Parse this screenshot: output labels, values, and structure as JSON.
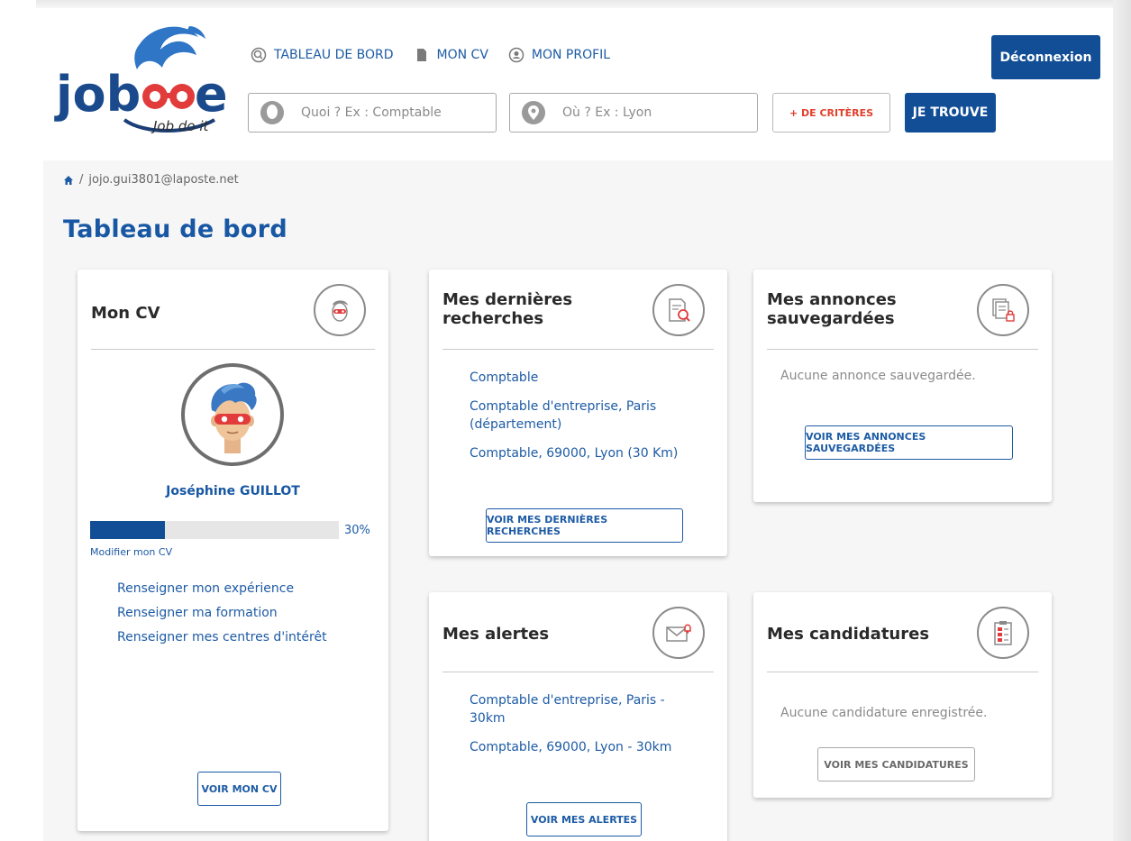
{
  "logo": {
    "brand": "jobdoe",
    "tagline": "Job do it"
  },
  "nav": [
    {
      "label": "TABLEAU DE BORD",
      "icon": "dashboard-icon"
    },
    {
      "label": "MON CV",
      "icon": "document-icon"
    },
    {
      "label": "MON PROFIL",
      "icon": "profile-icon"
    }
  ],
  "header": {
    "logout_label": "Déconnexion",
    "criteria_label": "+ DE CRITÈRES",
    "find_label": "JE TROUVE"
  },
  "search": {
    "what_placeholder": "Quoi ? Ex : Comptable",
    "where_placeholder": "Où ? Ex : Lyon"
  },
  "breadcrumb": {
    "separator": "/",
    "current": "jojo.gui3801@laposte.net"
  },
  "page_title": "Tableau de bord",
  "cv_card": {
    "title": "Mon CV",
    "name": "Joséphine GUILLOT",
    "progress_percent": 30,
    "progress_label": "30%",
    "edit_label": "Modifier mon CV",
    "links": [
      "Renseigner mon expérience",
      "Renseigner ma formation",
      "Renseigner mes centres d'intérêt"
    ],
    "button_label": "VOIR MON CV"
  },
  "searches_card": {
    "title_line1": "Mes dernières",
    "title_line2": "recherches",
    "items": [
      "Comptable",
      "Comptable d'entreprise, Paris (département)",
      "Comptable, 69000, Lyon (30 Km)"
    ],
    "button_label": "VOIR MES DERNIÈRES RECHERCHES"
  },
  "saved_card": {
    "title_line1": "Mes annonces",
    "title_line2": "sauvegardées",
    "empty_text": "Aucune annonce sauvegardée.",
    "button_label": "VOIR MES ANNONCES SAUVEGARDÉES"
  },
  "alerts_card": {
    "title": "Mes alertes",
    "items": [
      "Comptable d'entreprise, Paris - 30km",
      "Comptable, 69000, Lyon - 30km"
    ],
    "button_label": "VOIR MES ALERTES"
  },
  "applications_card": {
    "title": "Mes candidatures",
    "empty_text": "Aucune candidature enregistrée.",
    "button_label": "VOIR MES CANDIDATURES"
  },
  "colors": {
    "primary": "#124e95",
    "link": "#1d5ba5",
    "accent": "#e0412d",
    "background": "#f6f6f6"
  }
}
